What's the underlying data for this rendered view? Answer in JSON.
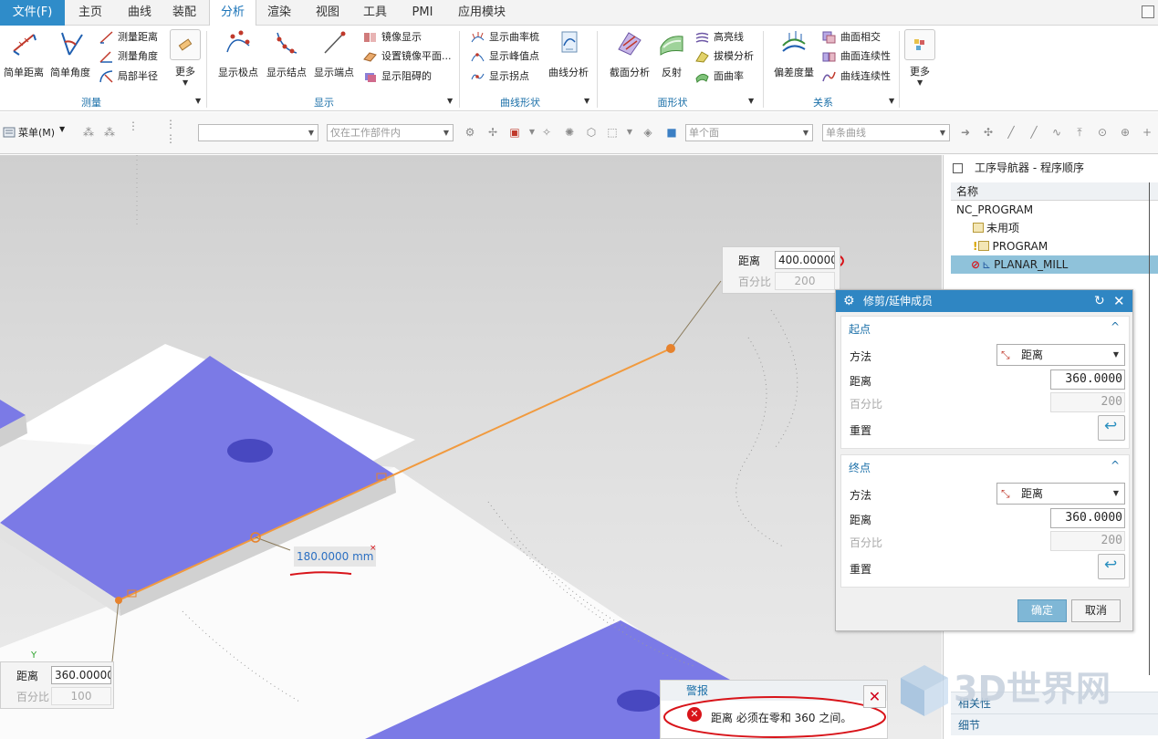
{
  "menu": {
    "file": "文件(F)",
    "tabs": [
      "主页",
      "曲线",
      "装配",
      "分析",
      "渲染",
      "视图",
      "工具",
      "PMI",
      "应用模块"
    ],
    "active_tab": "分析"
  },
  "ribbon": {
    "measure": {
      "big": [
        "简单距离",
        "简单角度"
      ],
      "small": [
        "测量距离",
        "测量角度",
        "局部半径"
      ],
      "more": "更多",
      "label": "测量"
    },
    "display": {
      "big": [
        "显示极点",
        "显示结点",
        "显示端点"
      ],
      "small": [
        "镜像显示",
        "设置镜像平面...",
        "显示阻碍的"
      ],
      "label": "显示"
    },
    "curve_shape": {
      "small": [
        "显示曲率梳",
        "显示峰值点",
        "显示拐点"
      ],
      "big": [
        "曲线分析"
      ],
      "label": "曲线形状"
    },
    "face_shape": {
      "big": [
        "截面分析",
        "反射"
      ],
      "small": [
        "高亮线",
        "拔模分析",
        "面曲率"
      ],
      "label": "面形状"
    },
    "relation": {
      "big": [
        "偏差度量"
      ],
      "small": [
        "曲面相交",
        "曲面连续性",
        "曲线连续性"
      ],
      "label": "关系"
    },
    "more": "更多"
  },
  "toolbar": {
    "menu_label": "菜单(M)",
    "combo_blank": "",
    "combo_scope": "仅在工作部件内",
    "combo_face": "单个面",
    "combo_curve": "单条曲线"
  },
  "viewport": {
    "top_measure": {
      "label": "距离",
      "value": "400.00000",
      "pct_label": "百分比",
      "pct_value": "200"
    },
    "bottom_measure": {
      "label": "距离",
      "value": "360.00000",
      "pct_label": "百分比",
      "pct_value": "100"
    },
    "dimension": "180.0000 mm",
    "axis_label": "Y"
  },
  "navigator": {
    "title": "工序导航器 - 程序顺序",
    "column": "名称",
    "items": [
      {
        "label": "NC_PROGRAM"
      },
      {
        "label": "未用项"
      },
      {
        "label": "PROGRAM"
      },
      {
        "label": "PLANAR_MILL"
      }
    ],
    "bottom_tabs": [
      "相关性",
      "细节"
    ]
  },
  "dialog": {
    "title": "修剪/延伸成员",
    "start": {
      "heading": "起点",
      "method_label": "方法",
      "method_value": "距离",
      "distance_label": "距离",
      "distance_value": "360.0000",
      "percent_label": "百分比",
      "percent_value": "200",
      "reset_label": "重置"
    },
    "end": {
      "heading": "终点",
      "method_label": "方法",
      "method_value": "距离",
      "distance_label": "距离",
      "distance_value": "360.0000",
      "percent_label": "百分比",
      "percent_value": "200",
      "reset_label": "重置"
    },
    "ok": "确定",
    "cancel": "取消"
  },
  "alert": {
    "title": "警报",
    "message": "距离 必须在零和 360 之间。"
  },
  "watermark": "3D世界网",
  "colors": {
    "accent": "#2f86c3",
    "part_face": "#7b7ae6",
    "trace": "#f19a3e",
    "annotation": "#d8141a"
  }
}
